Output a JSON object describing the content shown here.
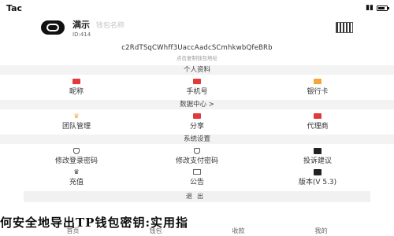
{
  "status": {
    "carrier": "Tac"
  },
  "profile": {
    "name": "满示",
    "name_sub": "钱包名称",
    "id": "ID:414"
  },
  "wallet": {
    "address": "c2RdTSqCWhff3UaccAadcSCmhkwbQfeBRb",
    "address_hint": "点击复制钱包地址"
  },
  "sections": {
    "personal": "个人资料",
    "data_center": "数据中心 >",
    "settings": "系统设置"
  },
  "personal_items": [
    {
      "label": "昵称",
      "icon": "user-card-icon"
    },
    {
      "label": "手机号",
      "icon": "phone-icon"
    },
    {
      "label": "银行卡",
      "icon": "bank-card-icon"
    }
  ],
  "data_items": [
    {
      "label": "团队管理",
      "icon": "crown-icon"
    },
    {
      "label": "分享",
      "icon": "share-icon"
    },
    {
      "label": "代理商",
      "icon": "agent-icon"
    }
  ],
  "settings_items": [
    {
      "label": "修改登录密码",
      "icon": "shield-icon"
    },
    {
      "label": "修改支付密码",
      "icon": "shield-icon"
    },
    {
      "label": "投诉建议",
      "icon": "feedback-icon"
    },
    {
      "label": "充值",
      "icon": "recharge-icon"
    },
    {
      "label": "公告",
      "icon": "notice-icon"
    },
    {
      "label": "版本(V 5.3)",
      "icon": "version-icon"
    }
  ],
  "logout_label": "退出",
  "bottom_nav": [
    "首页",
    "钱包",
    "收款",
    "我的"
  ],
  "overlay_title": "何安全地导出TP钱包密钥:实用指"
}
